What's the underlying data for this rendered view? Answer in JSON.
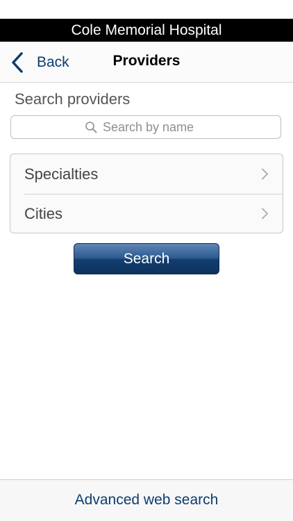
{
  "app": {
    "title": "Cole Memorial Hospital"
  },
  "nav": {
    "back_label": "Back",
    "title": "Providers"
  },
  "search": {
    "section_label": "Search providers",
    "placeholder": "Search by name",
    "value": ""
  },
  "filters": [
    {
      "label": "Specialties"
    },
    {
      "label": "Cities"
    }
  ],
  "actions": {
    "search_label": "Search"
  },
  "footer": {
    "advanced_label": "Advanced web search"
  },
  "colors": {
    "accent": "#0b3d6e",
    "title_bar_bg": "#000000",
    "button_top": "#5f86b5",
    "button_bottom": "#0e325d"
  },
  "icons": {
    "back": "chevron-left-icon",
    "search": "magnifier-icon",
    "row": "chevron-right-icon"
  }
}
